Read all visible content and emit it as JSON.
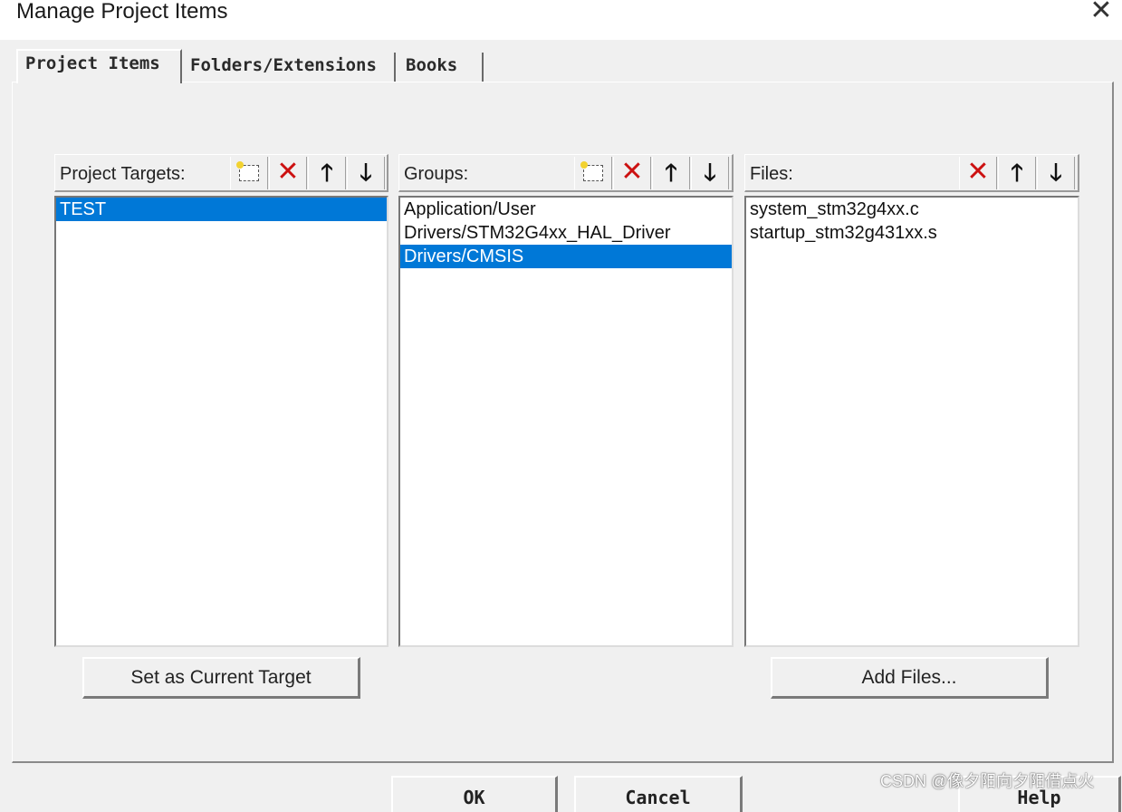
{
  "window": {
    "title": "Manage Project Items",
    "close_icon": "close-icon"
  },
  "tabs": [
    {
      "label": "Project Items",
      "active": true
    },
    {
      "label": "Folders/Extensions",
      "active": false
    },
    {
      "label": "Books",
      "active": false
    }
  ],
  "targets": {
    "header": "Project Targets:",
    "items": [
      "TEST"
    ],
    "selected": "TEST",
    "button_label": "Set as Current Target"
  },
  "groups": {
    "header": "Groups:",
    "items": [
      "Application/User",
      "Drivers/STM32G4xx_HAL_Driver",
      "Drivers/CMSIS"
    ],
    "selected": "Drivers/CMSIS"
  },
  "files": {
    "header": "Files:",
    "items": [
      "system_stm32g4xx.c",
      "startup_stm32g431xx.s"
    ],
    "button_label": "Add Files..."
  },
  "toolbar_icons": {
    "new": "new-item-icon",
    "delete": "delete-x-icon",
    "up": "move-up-arrow-icon",
    "down": "move-down-arrow-icon"
  },
  "footer": {
    "ok_label": "OK",
    "cancel_label": "Cancel",
    "help_label": "Help"
  },
  "watermark": "CSDN @像夕阳向夕阳借点火",
  "colors": {
    "selection": "#0078d7",
    "delete_icon": "#cc1111",
    "dialog_bg": "#f0f0f0"
  }
}
